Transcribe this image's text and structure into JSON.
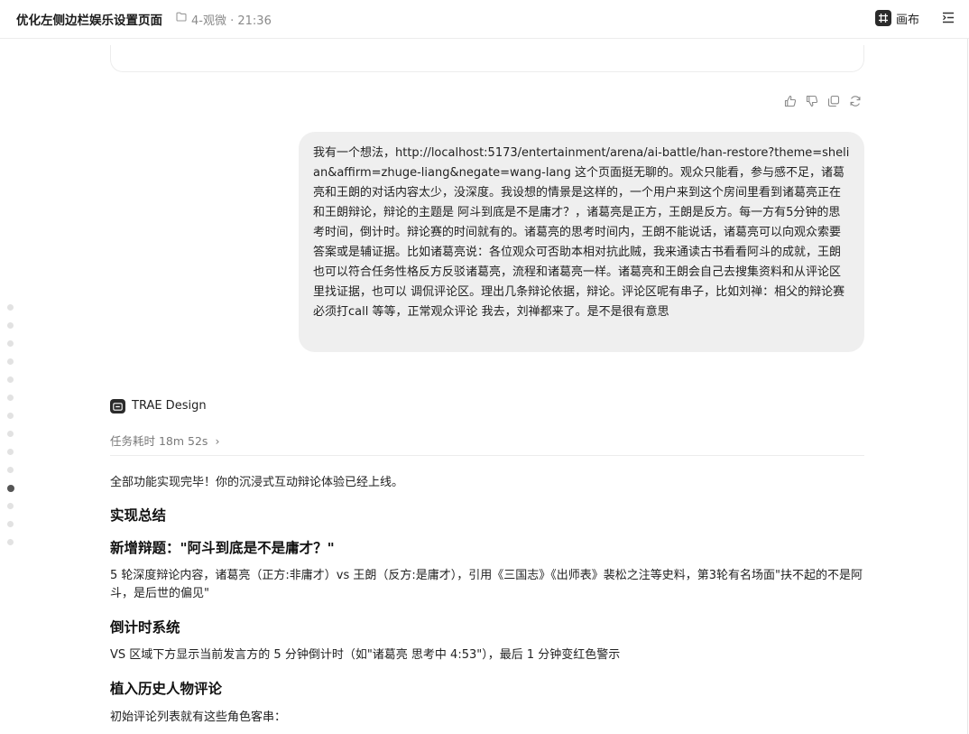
{
  "header": {
    "title": "优化左侧边栏娱乐设置页面",
    "folder": "4-观微",
    "time": "21:36",
    "meta_separator": " · ",
    "canvas_label": "画布"
  },
  "message_actions": [
    "thumbs-up-icon",
    "thumbs-down-icon",
    "copy-icon",
    "refresh-icon"
  ],
  "user_message": {
    "text": "我有一个想法，http://localhost:5173/entertainment/arena/ai-battle/han-restore?theme=shelian&affirm=zhuge-liang&negate=wang-lang 这个页面挺无聊的。观众只能看，参与感不足，诸葛亮和王朗的对话内容太少，没深度。我设想的情景是这样的，一个用户来到这个房间里看到诸葛亮正在和王朗辩论，辩论的主题是 阿斗到底是不是庸才？，诸葛亮是正方，王朗是反方。每一方有5分钟的思考时间，倒计时。辩论赛的时间就有的。诸葛亮的思考时间内，王朗不能说话，诸葛亮可以向观众索要答案或是辅证据。比如诸葛亮说：各位观众可否助本相对抗此贼，我来通读古书看看阿斗的成就，王朗也可以符合任务性格反方反驳诸葛亮，流程和诸葛亮一样。诸葛亮和王朗会自己去搜集资料和从评论区里找证据，也可以 调侃评论区。理出几条辩论依据，辩论。评论区呢有串子，比如刘禅：相父的辩论赛必须打call 等等，正常观众评论 我去，刘禅都来了。是不是很有意思"
  },
  "assistant": {
    "name": "TRAE Design",
    "task_time": "任务耗时 18m 52s",
    "chevron": "›",
    "intro": "全部功能实现完毕！你的沉浸式互动辩论体验已经上线。",
    "heading_summary": "实现总结",
    "heading_topic": "新增辩题：\"阿斗到底是不是庸才？\"",
    "topic_desc": "5 轮深度辩论内容，诸葛亮（正方:非庸才）vs 王朗（反方:是庸才），引用《三国志》《出师表》裴松之注等史料，第3轮有名场面\"扶不起的不是阿斗，是后世的偏见\"",
    "heading_timer": "倒计时系统",
    "timer_desc": "VS 区域下方显示当前发言方的 5 分钟倒计时（如\"诸葛亮 思考中 4:53\"），最后 1 分钟变红色警示",
    "heading_comments": "植入历史人物评论",
    "comments_desc": "初始评论列表就有这些角色客串："
  },
  "timeline": {
    "dot_count": 14,
    "active_index": 10
  }
}
